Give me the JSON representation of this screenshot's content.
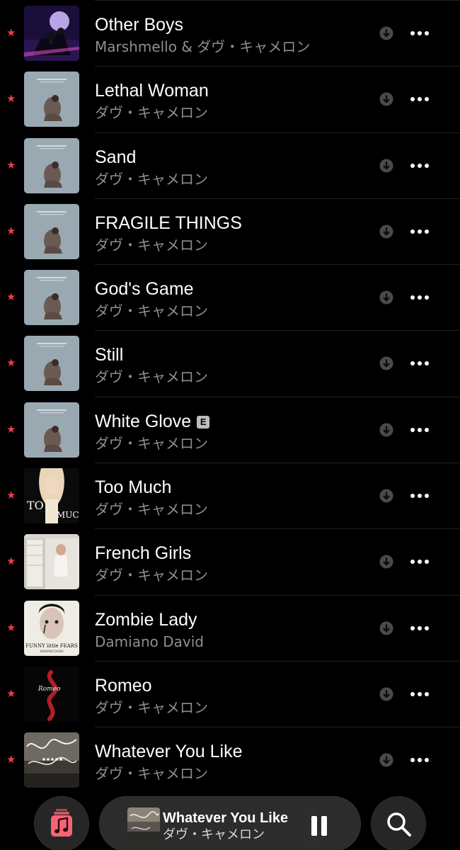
{
  "tracks": [
    {
      "title": "Other Boys",
      "artist": "Marshmello & ダヴ・キャメロン",
      "favorited": true,
      "explicit": false,
      "art": "other-boys"
    },
    {
      "title": "Lethal Woman",
      "artist": "ダヴ・キャメロン",
      "favorited": true,
      "explicit": false,
      "art": "dove-album"
    },
    {
      "title": "Sand",
      "artist": "ダヴ・キャメロン",
      "favorited": true,
      "explicit": false,
      "art": "dove-album"
    },
    {
      "title": "FRAGILE THINGS",
      "artist": "ダヴ・キャメロン",
      "favorited": true,
      "explicit": false,
      "art": "dove-album"
    },
    {
      "title": "God's Game",
      "artist": "ダヴ・キャメロン",
      "favorited": true,
      "explicit": false,
      "art": "dove-album"
    },
    {
      "title": "Still",
      "artist": "ダヴ・キャメロン",
      "favorited": true,
      "explicit": false,
      "art": "dove-album"
    },
    {
      "title": "White Glove",
      "artist": "ダヴ・キャメロン",
      "favorited": true,
      "explicit": true,
      "art": "dove-album"
    },
    {
      "title": "Too Much",
      "artist": "ダヴ・キャメロン",
      "favorited": true,
      "explicit": false,
      "art": "too-much"
    },
    {
      "title": "French Girls",
      "artist": "ダヴ・キャメロン",
      "favorited": true,
      "explicit": false,
      "art": "french-girls"
    },
    {
      "title": "Zombie Lady",
      "artist": "Damiano David",
      "favorited": true,
      "explicit": false,
      "art": "funny-little-fears"
    },
    {
      "title": "Romeo",
      "artist": "ダヴ・キャメロン",
      "favorited": true,
      "explicit": false,
      "art": "romeo"
    },
    {
      "title": "Whatever You Like",
      "artist": "ダヴ・キャメロン",
      "favorited": true,
      "explicit": false,
      "art": "whatever-you-like"
    }
  ],
  "explicit_badge": "E",
  "star_glyph": "★",
  "icons": {
    "favorite": "star-icon",
    "download": "download-arrow-icon",
    "more": "ellipsis-icon",
    "library": "music-library-icon",
    "pause": "pause-icon",
    "search": "search-icon"
  },
  "now_playing": {
    "title": "Whatever You Like",
    "artist": "ダヴ・キャメロン"
  },
  "colors": {
    "accent": "#f23a4c",
    "background": "#000000",
    "secondary_text": "#8e8e93"
  }
}
